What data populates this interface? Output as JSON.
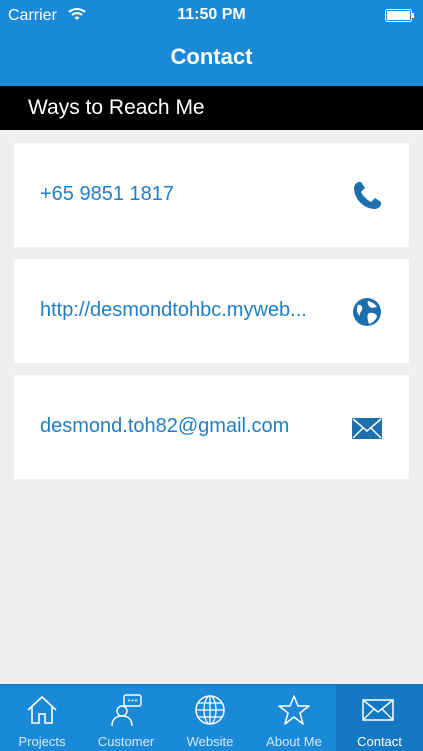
{
  "status_bar": {
    "carrier": "Carrier",
    "time": "11:50 PM",
    "wifi_icon": "wifi-icon",
    "battery_icon": "battery-icon"
  },
  "nav": {
    "title": "Contact"
  },
  "section": {
    "title": "Ways to Reach Me"
  },
  "contacts": [
    {
      "text": "+65 9851 1817",
      "icon": "phone-icon"
    },
    {
      "text": "http://desmondtohbc.myweb...",
      "icon": "globe-icon"
    },
    {
      "text": "desmond.toh82@gmail.com",
      "icon": "mail-icon"
    }
  ],
  "tabs": [
    {
      "label": "Projects",
      "icon": "home-icon",
      "selected": false
    },
    {
      "label": "Customer",
      "icon": "customer-chat-icon",
      "selected": false
    },
    {
      "label": "Website",
      "icon": "globe-icon",
      "selected": false
    },
    {
      "label": "About Me",
      "icon": "star-icon",
      "selected": false
    },
    {
      "label": "Contact",
      "icon": "mail-icon",
      "selected": true
    }
  ],
  "colors": {
    "header_blue": "#1a8ad8",
    "link_blue": "#1f7fc6",
    "icon_blue": "#1e6fae",
    "section_black": "#000000",
    "page_gray": "#efefef"
  }
}
